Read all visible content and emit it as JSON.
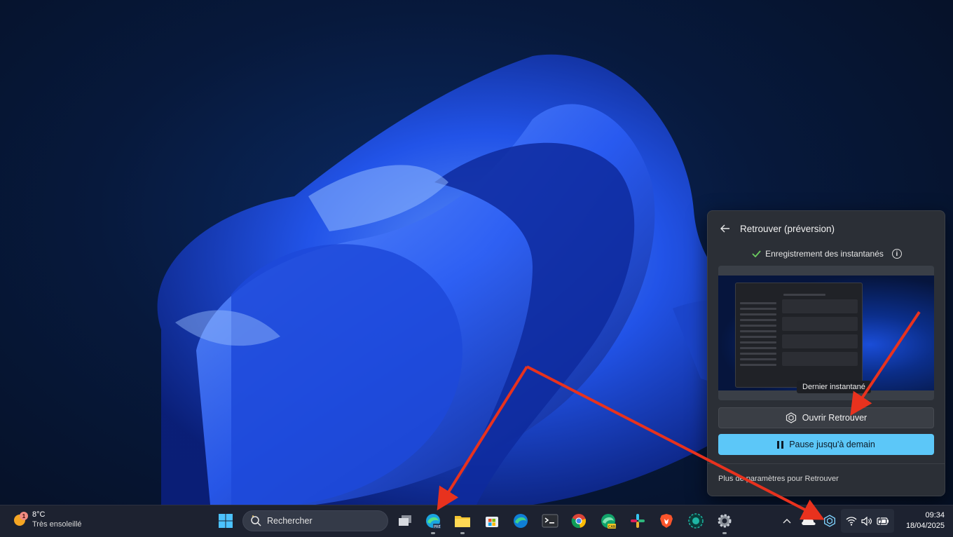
{
  "flyout": {
    "title": "Retrouver (préversion)",
    "status_text": "Enregistrement des instantanés",
    "snapshot_label": "Dernier instantané",
    "open_button_label": "Ouvrir Retrouver",
    "pause_button_label": "Pause jusqu'à demain",
    "more_settings_link": "Plus de paramètres pour Retrouver"
  },
  "taskbar": {
    "weather": {
      "badge": "1",
      "temperature": "8°C",
      "description": "Très ensoleillé"
    },
    "search_placeholder": "Rechercher",
    "pinned_apps": [
      "windows-start",
      "task-view",
      "edge-preview",
      "file-explorer",
      "microsoft-store",
      "edge",
      "terminal",
      "chrome",
      "edge-canary",
      "slack",
      "brave",
      "screen-recorder",
      "settings"
    ],
    "clock": {
      "time": "09:34",
      "date": "18/04/2025"
    }
  },
  "colors": {
    "accent": "#5cc7f8",
    "annotation_arrow": "#e8321e",
    "status_check": "#6ccb5f"
  }
}
